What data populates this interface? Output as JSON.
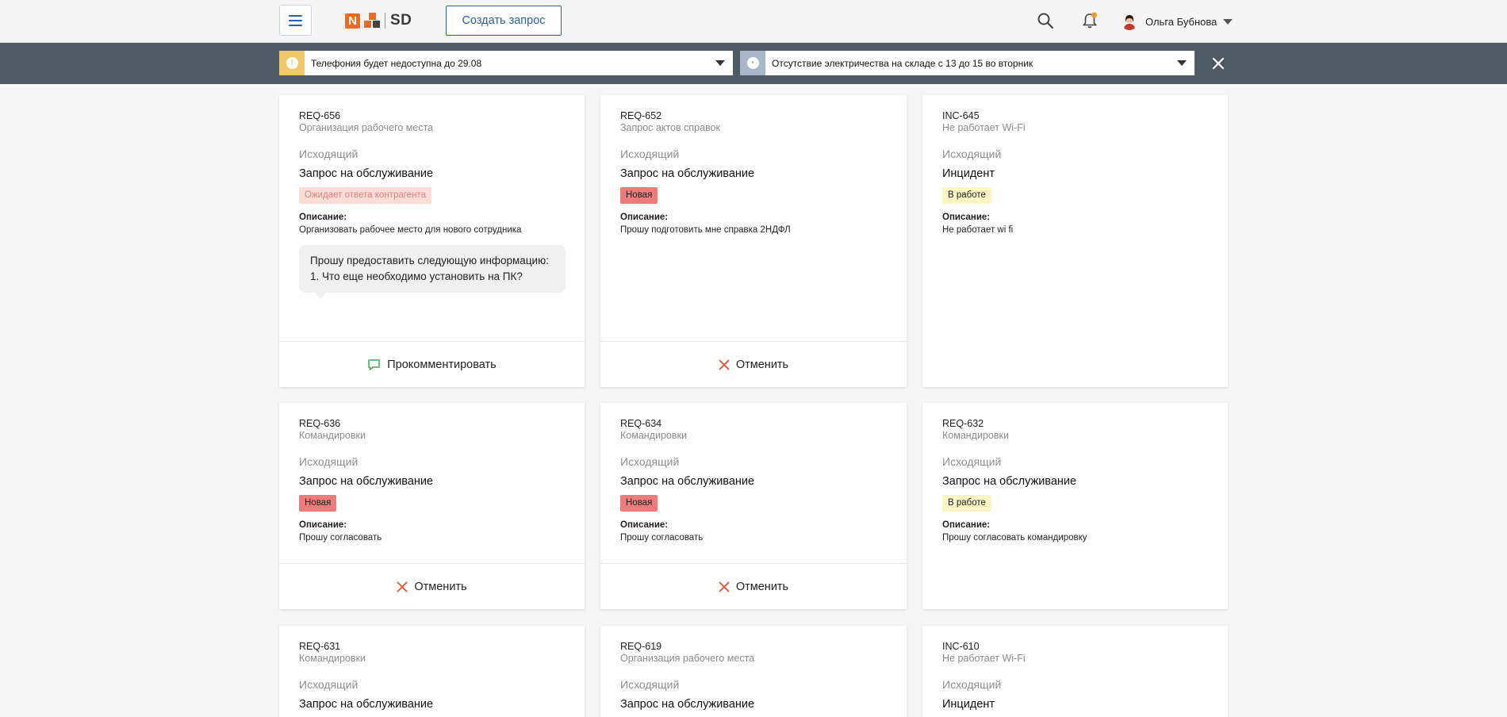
{
  "header": {
    "logo_text": "SD",
    "create_button": "Создать запрос",
    "user_name": "Ольга Бубнова"
  },
  "notices": [
    {
      "text": "Телефония будет недоступна до 29.08",
      "color": "#f2c96a",
      "icon": "exclamation-icon"
    },
    {
      "text": "Отсутствие электричества на складе с 13 до 15 во вторник",
      "color": "#a8b6c8",
      "icon": "info-icon"
    }
  ],
  "colors": {
    "accent": "#2a5fa8",
    "notice_bar": "#4e5a66",
    "badge_new": "#ee7b7b",
    "badge_work": "#fbf6c4",
    "badge_wait": "#fbdcd8",
    "cancel_red": "#e74c3c",
    "comment_green": "#3ca95c"
  },
  "cards": [
    {
      "id": "REQ-656",
      "subject": "Организация рабочего места",
      "direction": "Исходящий",
      "type": "Запрос на обслуживание",
      "status": "Ожидает ответа контрагента",
      "desc_label": "Описание:",
      "desc": "Организовать рабочее место для нового сотрудника",
      "bubble": "Прошу предоставить следующую информацию: 1. Что еще необходимо установить на ПК?",
      "action": "Прокомментировать"
    },
    {
      "id": "REQ-652",
      "subject": "Запрос актов справок",
      "direction": "Исходящий",
      "type": "Запрос на обслуживание",
      "status": "Новая",
      "desc_label": "Описание:",
      "desc": "Прошу подготовить мне справка 2НДФЛ",
      "action": "Отменить"
    },
    {
      "id": "INC-645",
      "subject": "Не работает Wi-Fi",
      "direction": "Исходящий",
      "type": "Инцидент",
      "status": "В работе",
      "desc_label": "Описание:",
      "desc": "Не работает wi fi"
    },
    {
      "id": "REQ-636",
      "subject": "Командировки",
      "direction": "Исходящий",
      "type": "Запрос на обслуживание",
      "status": "Новая",
      "desc_label": "Описание:",
      "desc": "Прошу согласовать",
      "action": "Отменить"
    },
    {
      "id": "REQ-634",
      "subject": "Командировки",
      "direction": "Исходящий",
      "type": "Запрос на обслуживание",
      "status": "Новая",
      "desc_label": "Описание:",
      "desc": "Прошу согласовать",
      "action": "Отменить"
    },
    {
      "id": "REQ-632",
      "subject": "Командировки",
      "direction": "Исходящий",
      "type": "Запрос на обслуживание",
      "status": "В работе",
      "desc_label": "Описание:",
      "desc": "Прошу согласовать командировку"
    },
    {
      "id": "REQ-631",
      "subject": "Командировки",
      "direction": "Исходящий",
      "type": "Запрос на обслуживание"
    },
    {
      "id": "REQ-619",
      "subject": "Организация рабочего места",
      "direction": "Исходящий",
      "type": "Запрос на обслуживание"
    },
    {
      "id": "INC-610",
      "subject": "Не работает Wi-Fi",
      "direction": "Исходящий",
      "type": "Инцидент"
    }
  ]
}
